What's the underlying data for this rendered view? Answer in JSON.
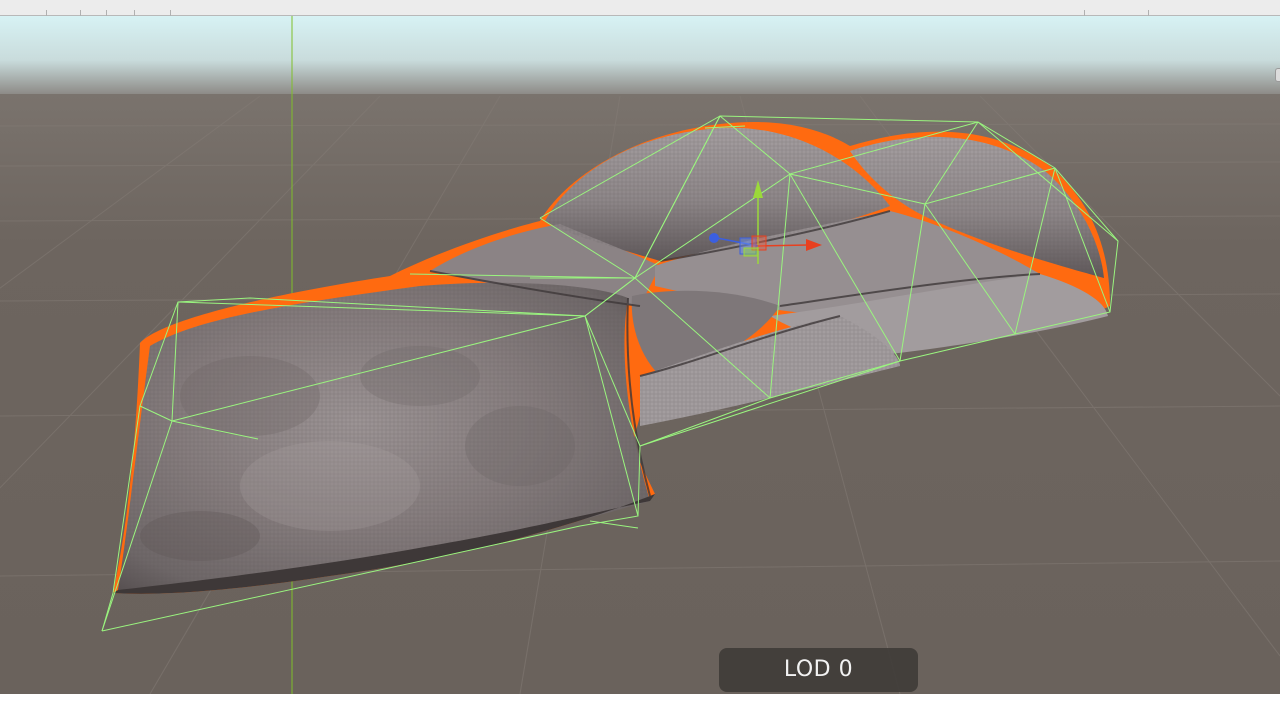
{
  "viewport": {
    "lod_label": "LOD 0"
  },
  "colors": {
    "sky_top": "#d8f1f3",
    "horizon": "#8c8985",
    "ground": "#6e6660",
    "grid_line": "#7e7771",
    "selection_outline": "#ff6a10",
    "wireframe": "#98f27e",
    "gizmo_x": "#e8401f",
    "gizmo_y": "#9bd93a",
    "gizmo_z": "#3b5fe0",
    "lod_badge_bg": "#3e3a37",
    "lod_badge_text": "#f2f2f2"
  },
  "icons": {
    "transform_gizmo": "move-tool-gizmo-icon"
  }
}
